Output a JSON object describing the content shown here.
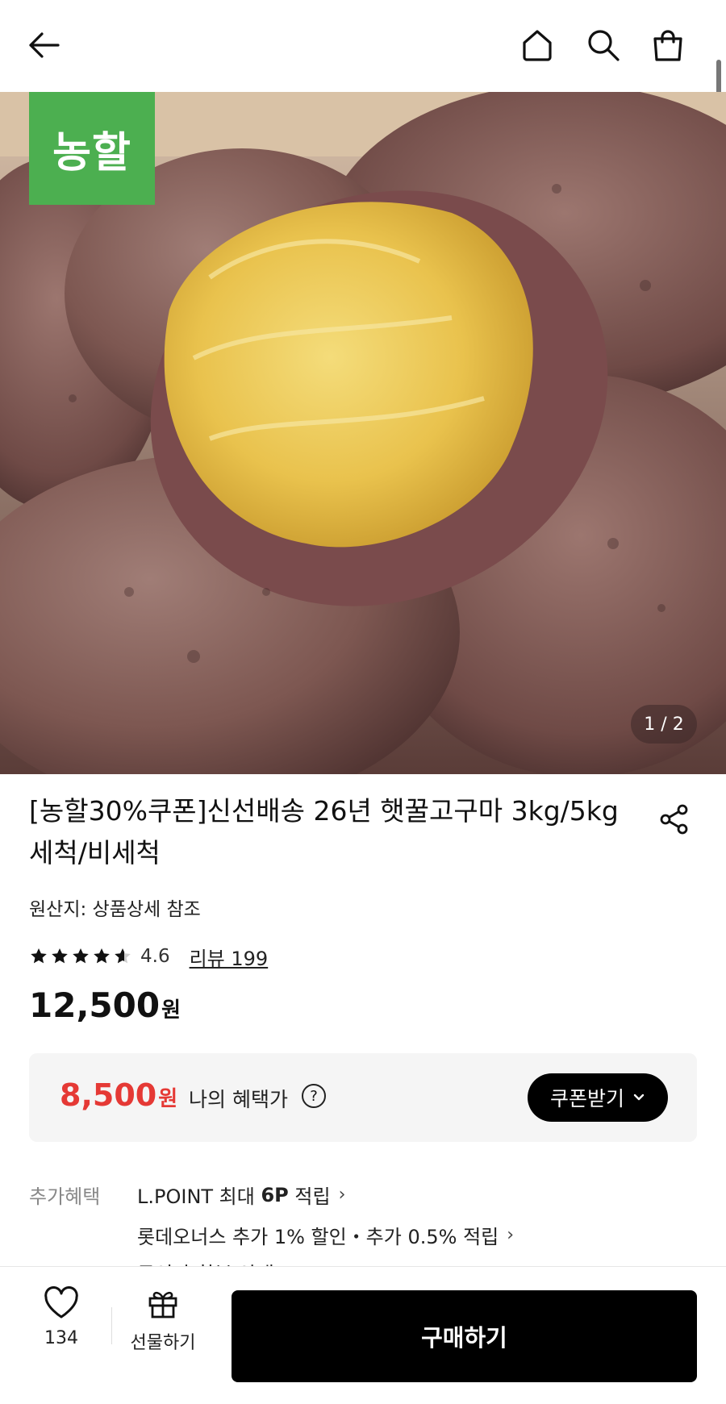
{
  "icons": {
    "back": "arrow-left-icon",
    "home": "home-icon",
    "search": "search-icon",
    "bag": "shopping-bag-icon",
    "share": "share-icon",
    "heart": "heart-icon",
    "gift": "gift-icon",
    "question": "question-circle-icon",
    "chevron": "chevron-right-icon"
  },
  "hero": {
    "brand_logo_text": "농할",
    "brand_color": "#4caf50",
    "page_indicator": "1 / 2"
  },
  "product": {
    "title": "[농할30%쿠폰]신선배송 26년 햇꿀고구마 3kg/5kg 세척/비세척",
    "origin": "원산지: 상품상세 참조",
    "rating": "4.6",
    "rating_stars": 4.6,
    "review_link": "리뷰 199",
    "price": "12,500",
    "price_unit": "원"
  },
  "benefit": {
    "price": "8,500",
    "price_unit": "원",
    "price_color": "#e53935",
    "label": "나의 혜택가",
    "question_mark": "?",
    "coupon_button": "쿠폰받기",
    "coupon_chevron": "⌄"
  },
  "extra_benefits": {
    "label": "추가혜택",
    "lpoint_prefix": "L.POINT 최대 ",
    "lpoint_bold": "6P",
    "lpoint_suffix": " 적립",
    "lotte_onnus": "롯데오너스 추가 1% 할인・추가 0.5% 적립",
    "partial_line": "무이자 할부 안내",
    "chevron": "›"
  },
  "bottom_bar": {
    "like_count": "134",
    "gift_label": "선물하기",
    "buy_button": "구매하기"
  }
}
